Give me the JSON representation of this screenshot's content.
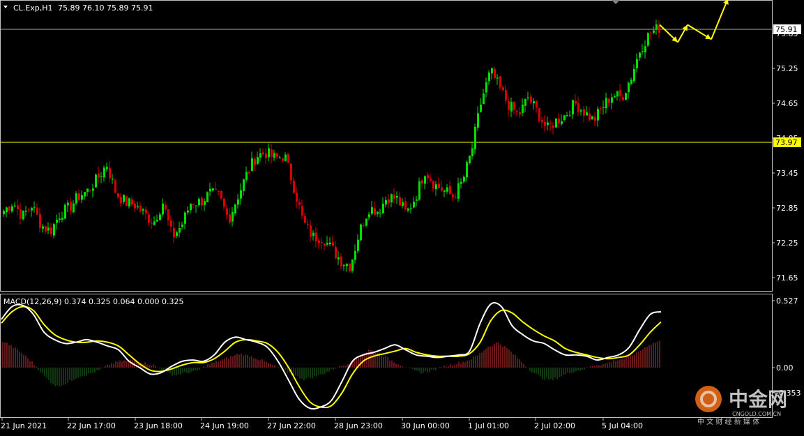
{
  "header": {
    "symbol_label": "CL.Exp,H1",
    "ohlc_label": "75.89 76.10 75.89 75.91"
  },
  "price_axis": {
    "ticks": [
      "75.85",
      "75.25",
      "74.65",
      "74.05",
      "73.45",
      "72.85",
      "72.25",
      "71.65"
    ],
    "current_price_label": "75.91",
    "hline_label": "73.97"
  },
  "macd": {
    "label": "MACD(12,26,9) 0.374 0.325 0.064 0.000 0.325",
    "ticks": [
      "0.527",
      "0.00",
      "-0.353"
    ]
  },
  "time_axis": {
    "labels": [
      "21 Jun 2021",
      "22 Jun 17:00",
      "23 Jun 18:00",
      "24 Jun 19:00",
      "27 Jun 22:00",
      "28 Jun 23:00",
      "30 Jun 00:00",
      "1 Jul 01:00",
      "2 Jul 02:00",
      "5 Jul 04:00"
    ]
  },
  "watermark": {
    "logo_text": "中金网",
    "domain_text": "CNGOLD.COM.CN",
    "tagline": "中 文 财 经 新 媒 体"
  },
  "colors": {
    "background": "#000000",
    "grid_border": "#c0c0c0",
    "bull_candle": "#00e000",
    "bear_candle": "#d80000",
    "hline": "#ffff00",
    "macd_line": "#ffffff",
    "signal_line": "#ffff00",
    "hist_pos": "#c83030",
    "hist_neg": "#207020",
    "arrow": "#ffff00",
    "logo_accent": "#e86a1a"
  },
  "chart_data": [
    {
      "type": "candlestick",
      "title": "CL.Exp,H1",
      "ylim": [
        71.45,
        76.25
      ],
      "current_price": 75.91,
      "horizontal_line": 73.97,
      "x_tick_labels": [
        "21 Jun 2021",
        "22 Jun 17:00",
        "23 Jun 18:00",
        "24 Jun 19:00",
        "27 Jun 22:00",
        "28 Jun 23:00",
        "30 Jun 00:00",
        "1 Jul 01:00",
        "2 Jul 02:00",
        "5 Jul 04:00"
      ],
      "close_path": [
        72.8,
        72.95,
        72.7,
        72.9,
        72.55,
        72.45,
        72.75,
        72.85,
        73.05,
        73.15,
        73.35,
        73.6,
        73.1,
        72.95,
        72.9,
        72.75,
        72.6,
        72.95,
        72.35,
        72.55,
        72.95,
        72.95,
        73.1,
        73.05,
        72.65,
        73.05,
        73.45,
        73.75,
        73.8,
        73.7,
        73.75,
        73.2,
        72.6,
        72.35,
        72.35,
        72.15,
        71.95,
        71.85,
        72.45,
        72.85,
        72.8,
        73.05,
        73.0,
        72.75,
        73.05,
        73.5,
        73.25,
        73.15,
        73.05,
        73.3,
        73.85,
        74.7,
        75.2,
        74.9,
        74.6,
        74.45,
        74.75,
        74.5,
        74.2,
        74.35,
        74.45,
        74.65,
        74.5,
        74.35,
        74.6,
        74.8,
        74.75,
        75.1,
        75.6,
        75.85,
        75.95
      ],
      "projection_arrows": [
        {
          "from": 76.0,
          "to": 75.7
        },
        {
          "from": 75.7,
          "to": 76.0
        },
        {
          "from": 76.0,
          "to": 75.75
        },
        {
          "from": 75.75,
          "to": 76.45
        }
      ]
    },
    {
      "type": "line",
      "title": "MACD(12,26,9) 0.374 0.325 0.064 0.000 0.325",
      "ylim": [
        -0.353,
        0.527
      ],
      "y_tick_labels": [
        "0.527",
        "0.00",
        "-0.353"
      ],
      "series": [
        {
          "name": "MACD",
          "values": [
            0.38,
            0.48,
            0.49,
            0.42,
            0.28,
            0.22,
            0.19,
            0.2,
            0.22,
            0.2,
            0.17,
            0.14,
            0.05,
            0.0,
            -0.05,
            -0.04,
            0.01,
            0.05,
            0.06,
            0.05,
            0.1,
            0.2,
            0.24,
            0.22,
            0.2,
            0.16,
            0.05,
            -0.1,
            -0.25,
            -0.32,
            -0.31,
            -0.26,
            -0.11,
            0.05,
            0.1,
            0.12,
            0.15,
            0.18,
            0.14,
            0.1,
            0.09,
            0.08,
            0.09,
            0.1,
            0.13,
            0.35,
            0.5,
            0.48,
            0.33,
            0.26,
            0.21,
            0.19,
            0.14,
            0.1,
            0.1,
            0.09,
            0.06,
            0.08,
            0.1,
            0.16,
            0.3,
            0.42,
            0.44
          ]
        },
        {
          "name": "Signal",
          "values": [
            0.35,
            0.44,
            0.48,
            0.45,
            0.34,
            0.26,
            0.22,
            0.2,
            0.2,
            0.21,
            0.2,
            0.17,
            0.1,
            0.03,
            -0.02,
            -0.03,
            -0.01,
            0.02,
            0.04,
            0.04,
            0.07,
            0.13,
            0.2,
            0.22,
            0.21,
            0.19,
            0.12,
            0.0,
            -0.15,
            -0.27,
            -0.31,
            -0.3,
            -0.2,
            -0.05,
            0.05,
            0.09,
            0.11,
            0.13,
            0.15,
            0.12,
            0.1,
            0.09,
            0.09,
            0.09,
            0.11,
            0.2,
            0.37,
            0.45,
            0.43,
            0.36,
            0.3,
            0.25,
            0.21,
            0.15,
            0.12,
            0.1,
            0.08,
            0.07,
            0.08,
            0.1,
            0.18,
            0.28,
            0.36
          ]
        }
      ],
      "histogram": [
        0.21,
        0.16,
        0.1,
        0.02,
        -0.08,
        -0.15,
        -0.12,
        -0.07,
        -0.05,
        -0.02,
        0.03,
        0.05,
        0.06,
        0.04,
        0.02,
        -0.03,
        -0.06,
        -0.04,
        -0.03,
        0.02,
        0.05,
        0.08,
        0.11,
        0.09,
        0.06,
        0.02,
        -0.02,
        -0.06,
        -0.09,
        -0.07,
        -0.04,
        0.0,
        0.03,
        0.08,
        0.14,
        0.11,
        0.06,
        0.02,
        -0.02,
        -0.04,
        -0.02,
        0.01,
        0.03,
        0.05,
        0.09,
        0.16,
        0.2,
        0.14,
        0.06,
        -0.02,
        -0.08,
        -0.1,
        -0.06,
        -0.03,
        -0.01,
        0.02,
        0.03,
        0.06,
        0.08,
        0.12,
        0.18,
        0.21
      ]
    }
  ]
}
